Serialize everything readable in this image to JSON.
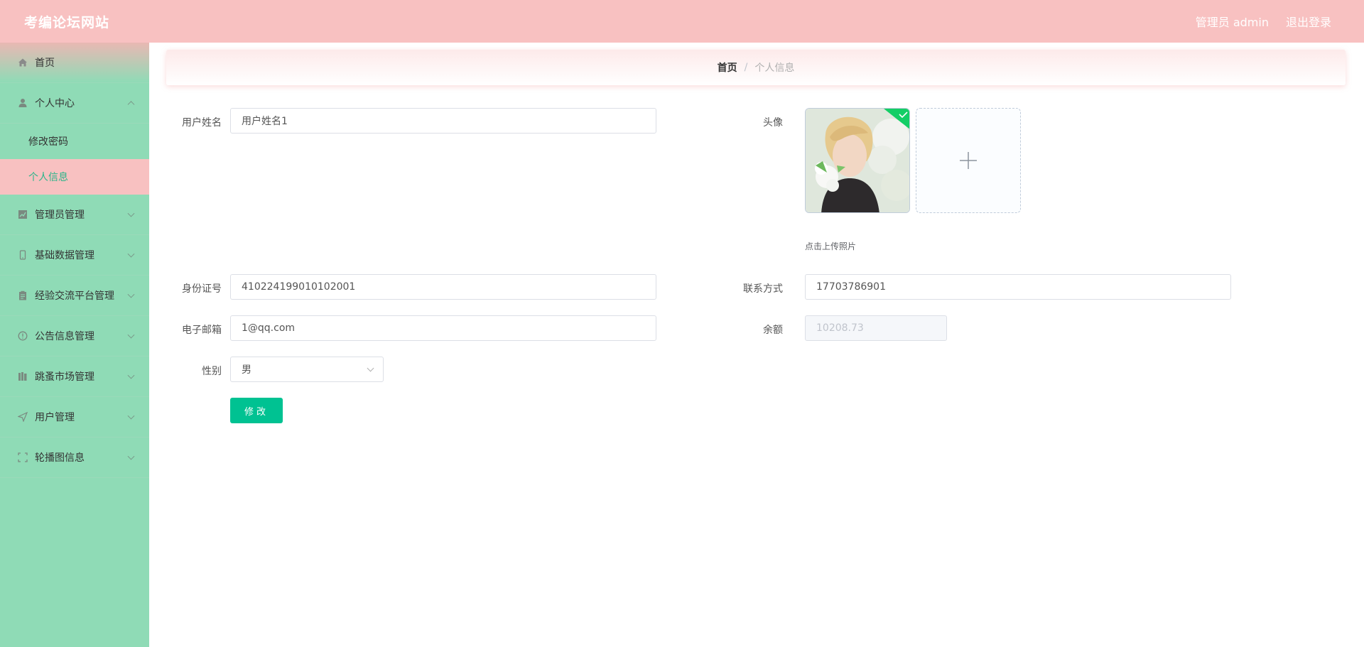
{
  "header": {
    "title": "考编论坛网站",
    "user_label": "管理员 admin",
    "logout_label": "退出登录"
  },
  "sidebar": {
    "items": [
      {
        "label": "首页",
        "icon": "home-icon"
      },
      {
        "label": "个人中心",
        "icon": "user-icon",
        "expanded": true,
        "children": [
          {
            "label": "修改密码",
            "active": false
          },
          {
            "label": "个人信息",
            "active": true
          }
        ]
      },
      {
        "label": "管理员管理",
        "icon": "chart-icon"
      },
      {
        "label": "基础数据管理",
        "icon": "mobile-icon"
      },
      {
        "label": "经验交流平台管理",
        "icon": "clipboard-icon"
      },
      {
        "label": "公告信息管理",
        "icon": "notice-icon"
      },
      {
        "label": "跳蚤市场管理",
        "icon": "books-icon"
      },
      {
        "label": "用户管理",
        "icon": "send-icon"
      },
      {
        "label": "轮播图信息",
        "icon": "fullscreen-icon"
      }
    ]
  },
  "breadcrumb": {
    "home": "首页",
    "separator": "/",
    "current": "个人信息"
  },
  "form": {
    "username": {
      "label": "用户姓名",
      "value": "用户姓名1"
    },
    "avatar": {
      "label": "头像",
      "upload_tip": "点击上传照片",
      "upload_icon": "plus-icon"
    },
    "id_number": {
      "label": "身份证号",
      "value": "410224199010102001"
    },
    "phone": {
      "label": "联系方式",
      "value": "17703786901"
    },
    "email": {
      "label": "电子邮箱",
      "value": "1@qq.com"
    },
    "balance": {
      "label": "余额",
      "value": "10208.73"
    },
    "gender": {
      "label": "性别",
      "value": "男"
    },
    "submit_label": "修改"
  },
  "colors": {
    "header_bg": "#f8c1c1",
    "sidebar_bg": "#8fdbb6",
    "active_item_bg": "#f8c1c1",
    "active_item_text": "#2bb58a",
    "primary_button": "#00c292"
  }
}
